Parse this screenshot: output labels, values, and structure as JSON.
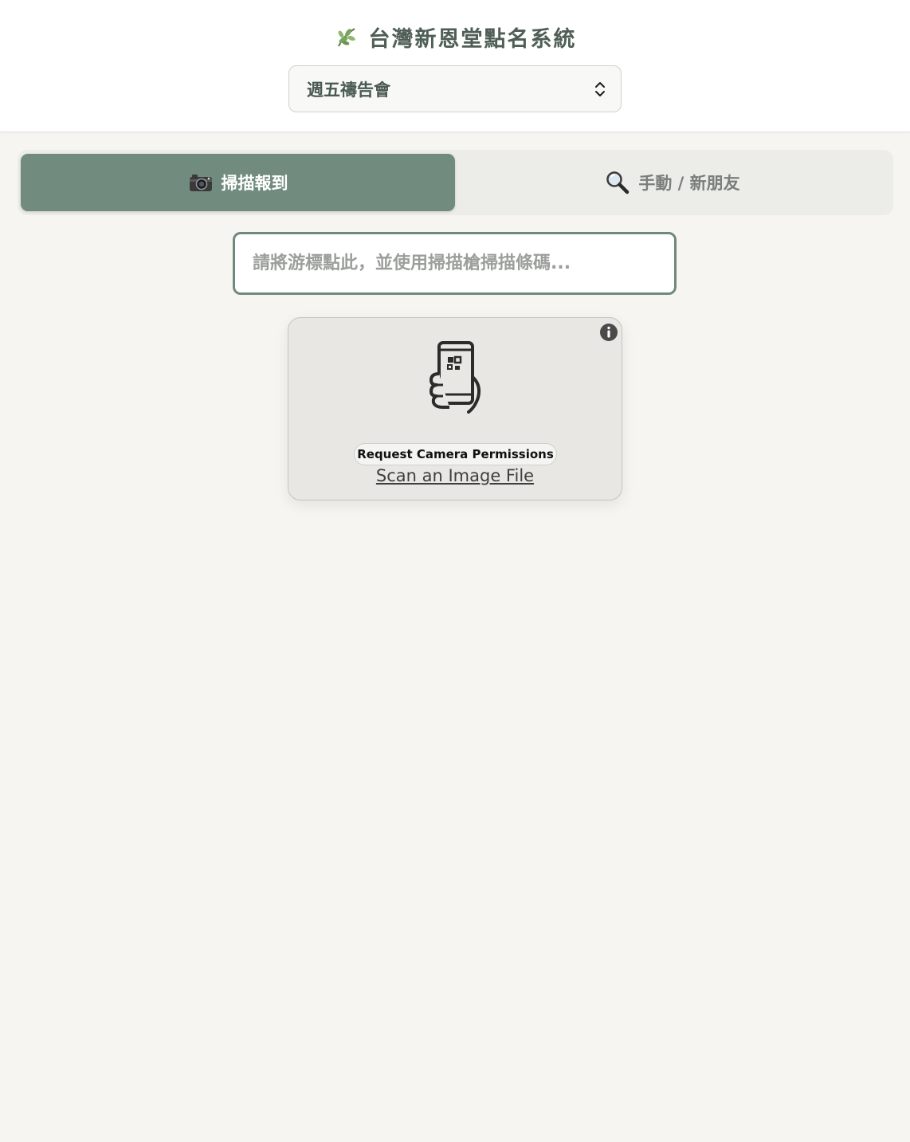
{
  "app": {
    "title": "台灣新恩堂點名系統",
    "logo_icon": "leaf-icon"
  },
  "service_select": {
    "value": "週五禱告會",
    "icon": "chevron-up-down-icon"
  },
  "tabs": [
    {
      "label": "掃描報到",
      "icon": "camera-icon",
      "active": true
    },
    {
      "label": "手動 / 新朋友",
      "icon": "magnifier-icon",
      "active": false
    }
  ],
  "barcode_input": {
    "value": "",
    "placeholder": "請將游標點此，並使用掃描槍掃描條碼..."
  },
  "scanner": {
    "illustration_icon": "phone-qr-scan-icon",
    "info_icon": "info-icon",
    "permission_button": "Request Camera Permissions",
    "file_link": "Scan an Image File"
  },
  "colors": {
    "accent": "#718c7e",
    "accent_border": "#6d8a7b",
    "background": "#f6f5f2",
    "title_text": "#4f5e56"
  }
}
